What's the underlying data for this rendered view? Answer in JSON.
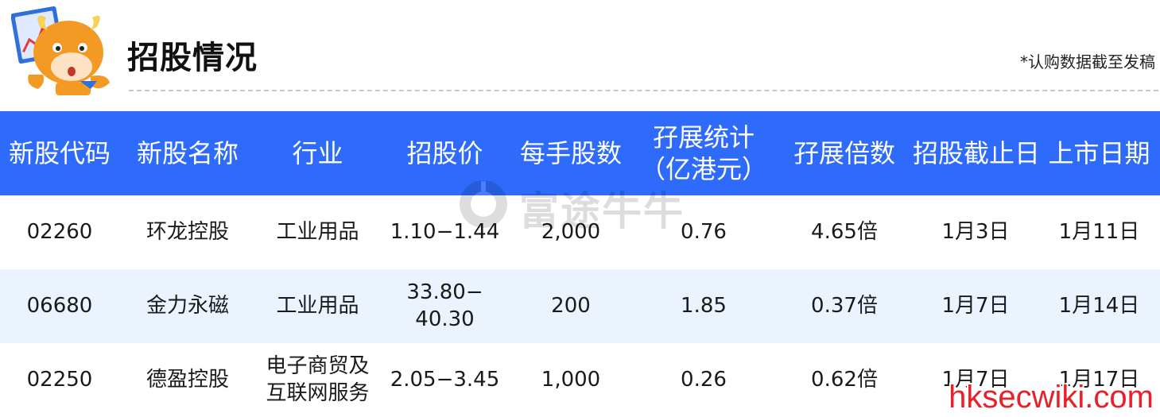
{
  "header": {
    "title": "招股情况",
    "note": "*认购数据截至发稿"
  },
  "table": {
    "columns": [
      "新股代码",
      "新股名称",
      "行业",
      "招股价",
      "每手股数",
      "孖展统计（亿港元）",
      "孖展倍数",
      "招股截止日",
      "上市日期"
    ],
    "column_lines": {
      "margin_stats_line1": "孖展统计",
      "margin_stats_line2": "（亿港元）"
    },
    "rows": [
      {
        "code": "02260",
        "name": "环龙控股",
        "industry": "工业用品",
        "industry_line2": "",
        "price": "1.10−1.44",
        "price_line2": "",
        "lot": "2,000",
        "margin": "0.76",
        "multiple": "4.65倍",
        "close_date": "1月3日",
        "listing_date": "1月11日"
      },
      {
        "code": "06680",
        "name": "金力永磁",
        "industry": "工业用品",
        "industry_line2": "",
        "price": "33.80−",
        "price_line2": "40.30",
        "lot": "200",
        "margin": "1.85",
        "multiple": "0.37倍",
        "close_date": "1月7日",
        "listing_date": "1月14日"
      },
      {
        "code": "02250",
        "name": "德盈控股",
        "industry": "电子商贸及",
        "industry_line2": "互联网服务",
        "price": "2.05−3.45",
        "price_line2": "",
        "lot": "1,000",
        "margin": "0.26",
        "multiple": "0.62倍",
        "close_date": "1月7日",
        "listing_date": "1月17日"
      }
    ]
  },
  "watermark": {
    "text": "富途牛牛"
  },
  "site_watermark": {
    "text": "hksecwiki.com"
  },
  "colors": {
    "header_bg": "#2e6bfa",
    "alt_row_bg": "#eaf3fe",
    "site_watermark": "#e8202a"
  },
  "icons": {
    "mascot": "cartoon-bull-mascot-icon",
    "watermark_logo": "futu-logo-icon"
  }
}
